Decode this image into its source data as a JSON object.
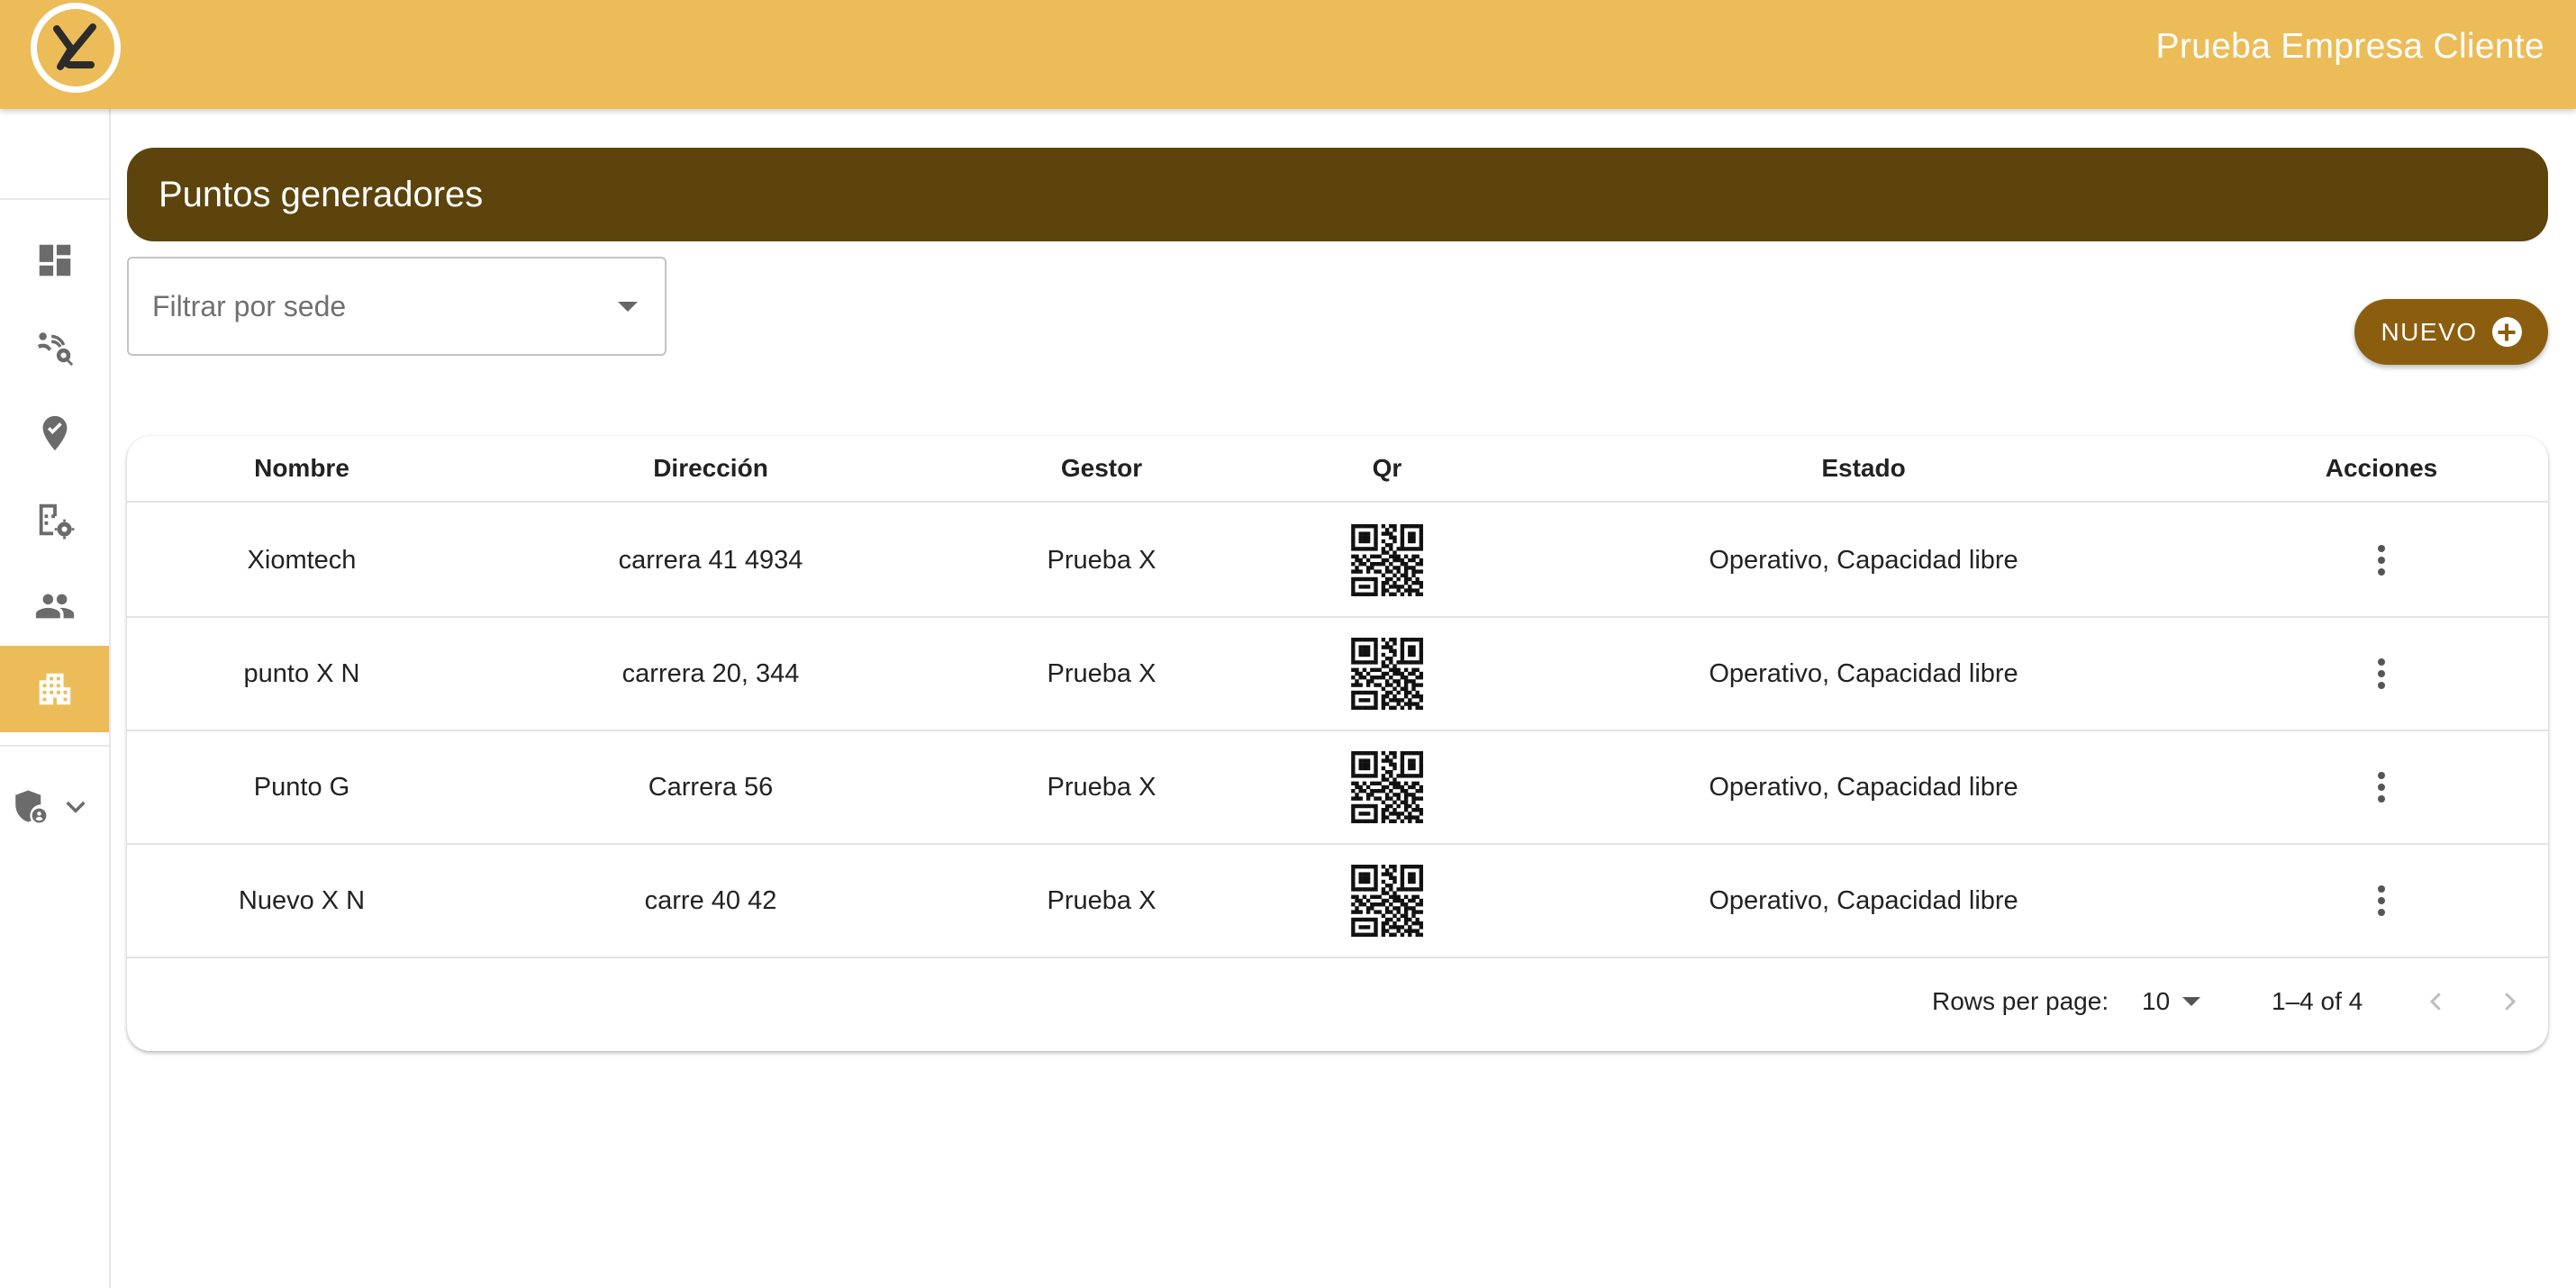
{
  "header": {
    "client_name": "Prueba Empresa Cliente",
    "brand_color": "#ecbc58"
  },
  "sidebar": {
    "items": [
      {
        "icon": "dashboard-icon",
        "active": false
      },
      {
        "icon": "route-tracking-icon",
        "active": false
      },
      {
        "icon": "location-check-icon",
        "active": false
      },
      {
        "icon": "building-settings-icon",
        "active": false
      },
      {
        "icon": "people-icon",
        "active": false
      },
      {
        "icon": "apartment-icon",
        "active": true
      },
      {
        "icon": "admin-shield-icon",
        "active": false,
        "expandable": true
      }
    ]
  },
  "page": {
    "title": "Puntos generadores",
    "title_bar_color": "#5c440c",
    "filter_placeholder": "Filtrar por sede",
    "new_button_label": "NUEVO",
    "new_button_color": "#8b5e0f"
  },
  "table": {
    "columns": [
      "Nombre",
      "Dirección",
      "Gestor",
      "Qr",
      "Estado",
      "Acciones"
    ],
    "rows": [
      {
        "nombre": "Xiomtech",
        "direccion": "carrera 41 4934",
        "gestor": "Prueba X",
        "estado": "Operativo, Capacidad libre"
      },
      {
        "nombre": "punto X N",
        "direccion": "carrera 20, 344",
        "gestor": "Prueba X",
        "estado": "Operativo, Capacidad libre"
      },
      {
        "nombre": "Punto G",
        "direccion": "Carrera 56",
        "gestor": "Prueba X",
        "estado": "Operativo, Capacidad libre"
      },
      {
        "nombre": "Nuevo X N",
        "direccion": "carre 40 42",
        "gestor": "Prueba X",
        "estado": "Operativo, Capacidad libre"
      }
    ]
  },
  "pagination": {
    "rows_per_page_label": "Rows per page:",
    "rows_per_page_value": "10",
    "range_text": "1–4 of 4"
  }
}
